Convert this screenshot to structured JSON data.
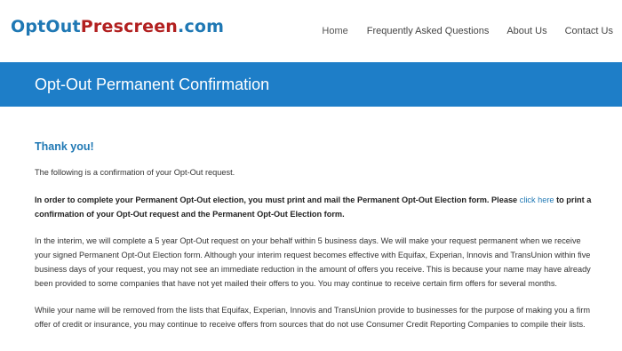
{
  "header": {
    "logo_part1": "OptOut",
    "logo_part2": "Prescreen",
    "logo_part3": ".com",
    "nav": {
      "home": "Home",
      "faq": "Frequently Asked Questions",
      "about": "About Us",
      "contact": "Contact Us"
    }
  },
  "banner": {
    "title": "Opt-Out Permanent Confirmation"
  },
  "content": {
    "heading": "Thank you!",
    "intro": "The following is a confirmation of your Opt-Out request.",
    "bold_before_link": "In order to complete your Permanent Opt-Out election, you must print and mail the Permanent Opt-Out Election form. Please ",
    "link_text": "click here",
    "bold_after_link": " to print a confirmation of your Opt-Out request and the Permanent Opt-Out Election form.",
    "paragraph_interim": "In the interim, we will complete a 5 year Opt-Out request on your behalf within 5 business days. We will make your request permanent when we receive your signed Permanent Opt-Out Election form. Although your interim request becomes effective with Equifax, Experian, Innovis and TransUnion within five business days of your request, you may not see an immediate reduction in the amount of offers you receive. This is because your name may have already been provided to some companies that have not yet mailed their offers to you. You may continue to receive certain firm offers for several months.",
    "paragraph_removed": "While your name will be removed from the lists that Equifax, Experian, Innovis and TransUnion provide to businesses for the purpose of making you a firm offer of credit or insurance, you may continue to receive offers from sources that do not use Consumer Credit Reporting Companies to compile their lists."
  },
  "colors": {
    "brand_blue": "#1f78b4",
    "brand_red": "#b22020",
    "banner_bg": "#1e7ec8"
  }
}
